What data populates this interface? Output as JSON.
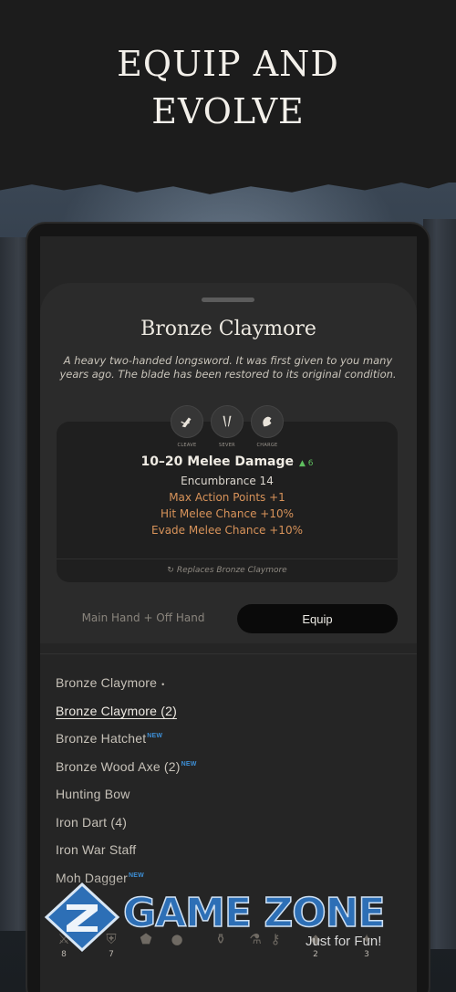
{
  "promo": {
    "headline_line1": "EQUIP AND",
    "headline_line2": "EVOLVE"
  },
  "item": {
    "name": "Bronze Claymore",
    "description": "A heavy two-handed longsword. It was first given to you many years ago. The blade has been restored to its original condition.",
    "skills": [
      {
        "label": "CLEAVE",
        "icon": "cleave-icon"
      },
      {
        "label": "SEVER",
        "icon": "sever-icon"
      },
      {
        "label": "CHARGE",
        "icon": "charge-icon"
      }
    ],
    "damage": "10–20 Melee Damage",
    "damage_delta": "▲ 6",
    "encumbrance": "Encumbrance 14",
    "bonuses": [
      "Max Action Points +1",
      "Hit Melee Chance +10%",
      "Evade Melee Chance +10%"
    ],
    "replaces_icon": "↻",
    "replaces": "Replaces Bronze Claymore"
  },
  "actions": {
    "slot_label": "Main Hand + Off Hand",
    "equip_label": "Equip"
  },
  "inventory": [
    {
      "name": "Bronze Claymore",
      "marker": "•",
      "badge": ""
    },
    {
      "name": "Bronze Claymore (2)",
      "marker": "",
      "badge": ""
    },
    {
      "name": "Bronze Hatchet",
      "marker": "",
      "badge": "NEW"
    },
    {
      "name": "Bronze Wood Axe (2)",
      "marker": "",
      "badge": "NEW"
    },
    {
      "name": "Hunting Bow",
      "marker": "",
      "badge": ""
    },
    {
      "name": "Iron Dart (4)",
      "marker": "",
      "badge": ""
    },
    {
      "name": "Iron War Staff",
      "marker": "",
      "badge": ""
    },
    {
      "name": "Moh Dagger",
      "marker": "",
      "badge": "NEW"
    }
  ],
  "toolbar": [
    {
      "icon": "weapon-icon",
      "glyph": "⚔",
      "count": "8"
    },
    {
      "icon": "armor-icon",
      "glyph": "⛨",
      "count": "7"
    },
    {
      "icon": "shield-icon",
      "glyph": "⬟",
      "count": ""
    },
    {
      "icon": "orb-icon",
      "glyph": "●",
      "count": ""
    },
    {
      "icon": "potion-icon",
      "glyph": "⚱",
      "count": ""
    },
    {
      "icon": "flask-icon",
      "glyph": "⚗",
      "count": ""
    },
    {
      "icon": "key-icon",
      "glyph": "⚷",
      "count": ""
    },
    {
      "icon": "pouch-icon",
      "glyph": "◆",
      "count": "2"
    },
    {
      "icon": "misc-icon",
      "glyph": "✦",
      "count": "3"
    }
  ],
  "watermark": {
    "brand": "GAME ZONE",
    "tagline": "Just for Fun!"
  },
  "colors": {
    "accent_new": "#3d8fd6",
    "bonus_orange": "#d8935a",
    "delta_green": "#5fbf5f",
    "brand_blue": "#2d6fb6"
  }
}
